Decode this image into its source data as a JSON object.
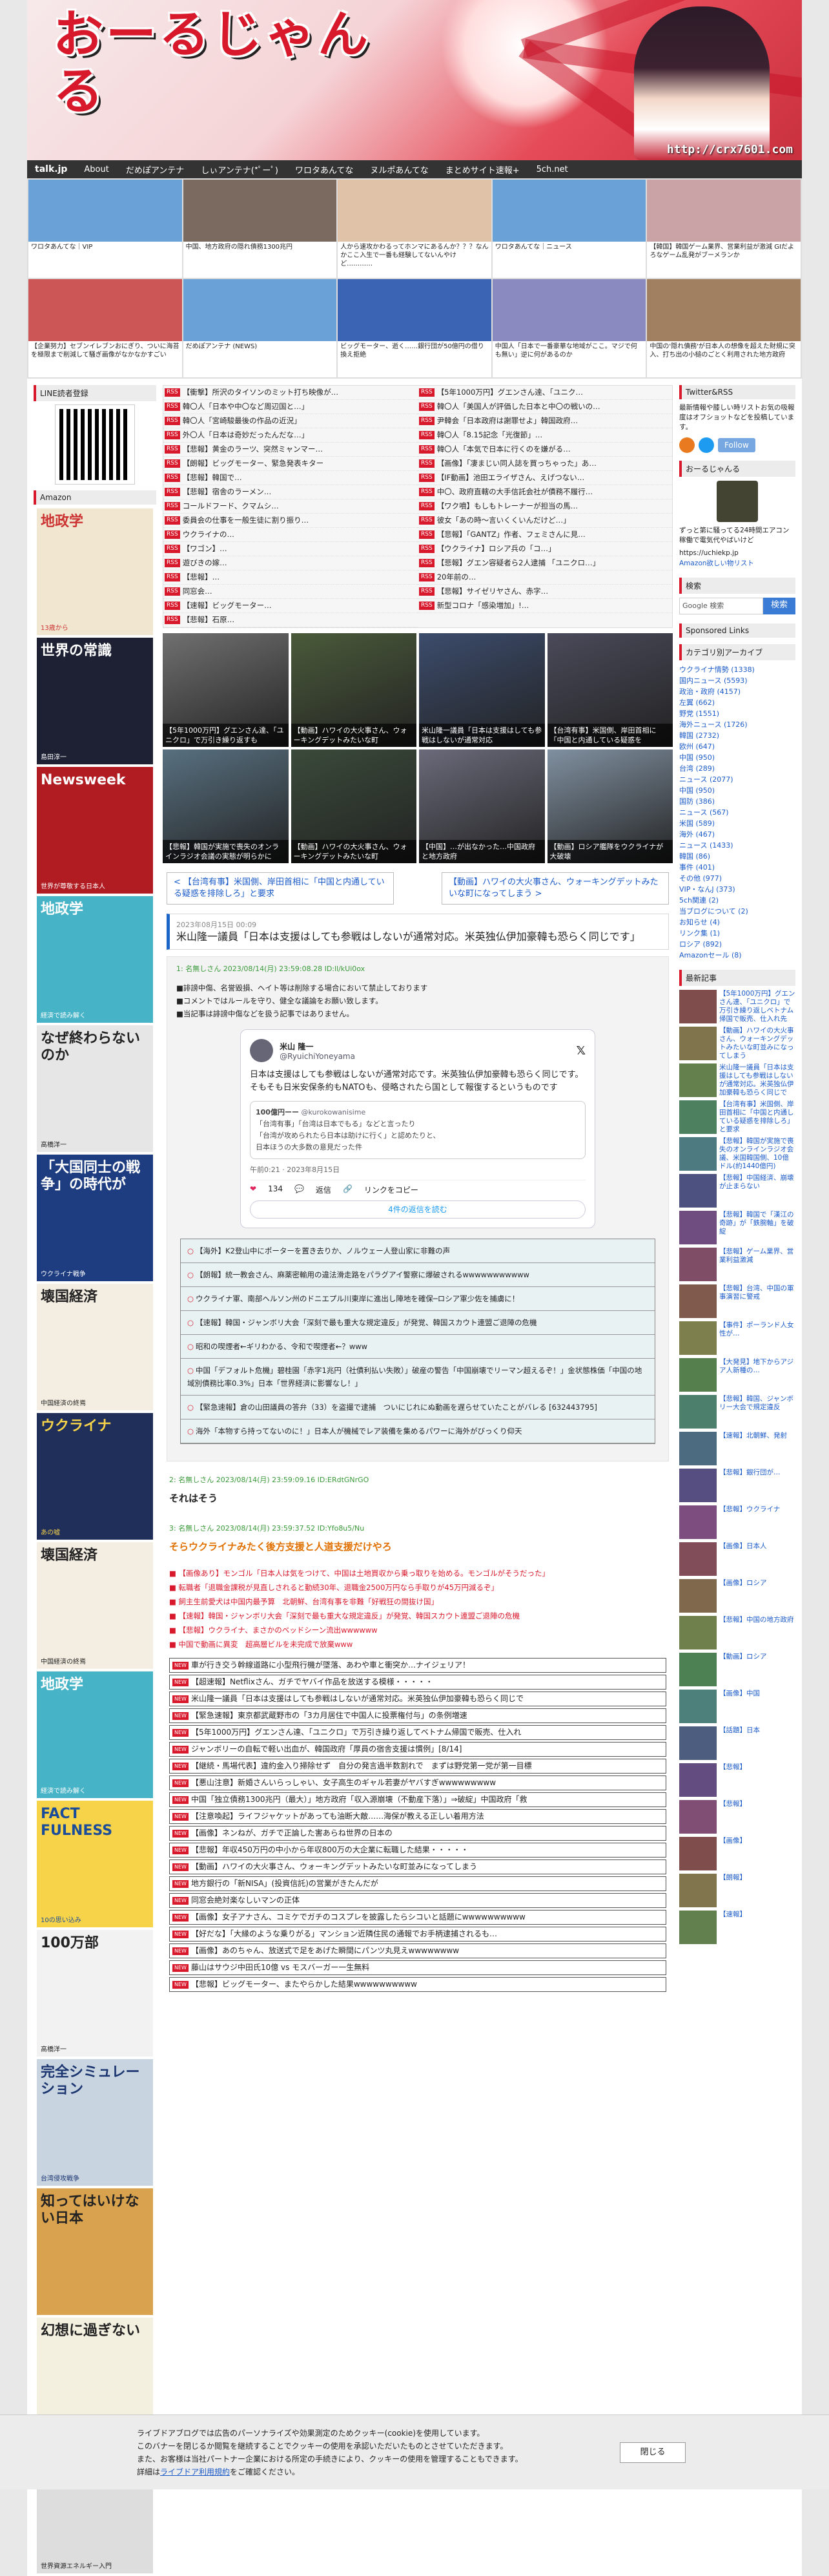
{
  "site": {
    "logo_text": "おーるじゃんる",
    "url_text": "http://crx7601.com"
  },
  "nav": [
    "talk.jp",
    "About",
    "だめぽアンテナ",
    "しぃアンテナ(*ﾟーﾟ)",
    "ワロタあんてな",
    "ヌルポあんてな",
    "まとめサイト速報+",
    "5ch.net"
  ],
  "antena": [
    {
      "cap": "ワロタあんてな｜VIP",
      "bg": "#6aa1d6"
    },
    {
      "cap": "中国、地方政府の隠れ債務1300兆円",
      "bg": "#7b6a5f"
    },
    {
      "cap": "人から速攻かわるってホンマにあるんか？？？なんかここ入生で一番も経験してないんやけど…………",
      "bg": "#e0c2a8"
    },
    {
      "cap": "ワロタあんてな｜ニュース",
      "bg": "#6aa1d6"
    },
    {
      "cap": "【韓国】韓国ゲーム業界、営業利益が激減 GIだよろなゲーム乱発がブーメランか",
      "bg": "#c9a3a6"
    },
    {
      "cap": "【企業努力】セブンイレブンおにぎり、ついに海苔を極限まで削減して騒ぎ画像がなかなかすごい",
      "bg": "#c55"
    },
    {
      "cap": "だめぽアンテナ (NEWS)",
      "bg": "#6aa1d6"
    },
    {
      "cap": "ビッグモーター、逝く……銀行団が50億円の借り換え拒絶",
      "bg": "#3b64b4"
    },
    {
      "cap": "中国人「日本で一番豪華な地域がここ。マジで何も無い」逆に何があるのか",
      "bg": "#8a8ac0"
    },
    {
      "cap": "中国の'隠れ債務'が日本人の想像を超えた財規に突入、打ち出の小槌のごとく利用された地方政府",
      "bg": "#a08060"
    }
  ],
  "left": {
    "line_title": "LINE読者登録",
    "amazon_title": "Amazon",
    "books": [
      {
        "t": "地政学",
        "s": "13歳から",
        "bg": "#f1e7d0",
        "fg": "#c33"
      },
      {
        "t": "世界の常識",
        "s": "島田淳一",
        "bg": "#1d2133",
        "fg": "#fff"
      },
      {
        "t": "Newsweek",
        "s": "世界が尊敬する日本人",
        "bg": "#b01c22",
        "fg": "#fff"
      },
      {
        "t": "地政学",
        "s": "経済で読み解く",
        "bg": "#47b3c7",
        "fg": "#fff"
      },
      {
        "t": "なぜ終わらないのか",
        "s": "高橋洋一",
        "bg": "#e6e6e6",
        "fg": "#222"
      },
      {
        "t": "「大国同士の戦争」の時代が",
        "s": "ウクライナ戦争",
        "bg": "#1d3d80",
        "fg": "#fff"
      },
      {
        "t": "壊国経済",
        "s": "中国経済の終焉",
        "bg": "#f4eee2",
        "fg": "#222"
      },
      {
        "t": "ウクライナ",
        "s": "あの嘘",
        "bg": "#1f2f5a",
        "fg": "#f7d34a"
      },
      {
        "t": "壊国経済",
        "s": "中国経済の終焉",
        "bg": "#f4eee2",
        "fg": "#222"
      },
      {
        "t": "地政学",
        "s": "経済で読み解く",
        "bg": "#47b3c7",
        "fg": "#fff"
      },
      {
        "t": "FACT FULNESS",
        "s": "10の思い込み",
        "bg": "#f7d34a",
        "fg": "#1b4c99"
      },
      {
        "t": "100万部",
        "s": "高橋洋一",
        "bg": "#f2f2f2",
        "fg": "#222"
      },
      {
        "t": "完全シミュレーション",
        "s": "台湾侵攻戦争",
        "bg": "#c8d4e0",
        "fg": "#1b3570"
      },
      {
        "t": "知ってはいけない日本",
        "s": "",
        "bg": "#d9a24f",
        "fg": "#222"
      },
      {
        "t": "幻想に過ぎない",
        "s": "",
        "bg": "#f4f0e0",
        "fg": "#222"
      },
      {
        "t": "日本が再エネ",
        "s": "世界資源エネルギー入門",
        "bg": "#ddd",
        "fg": "#222"
      }
    ]
  },
  "rss_left": [
    "【衝撃】所沢のタイソンのミット打ち映像が…",
    "韓〇人「日本や中〇など周辺国と…」",
    "韓〇人「宮崎駿最後の作品の近況」",
    "外〇人「日本は奇妙だったんだな…」",
    "【悲報】黄金のラーツ、突然ミャンマー…",
    "【朗報】ビッグモーター、緊急発表キター",
    "【悲報】韓国で…",
    "【悲報】宿舎のラーメン…",
    "コールドフード、クマムシ…",
    "委員会の仕事を一般生徒に割り振り…",
    "ウクライナの…",
    "【ワゴン】…",
    "遊びきの嫁…",
    "【悲報】…",
    "同窓会…",
    "【速報】ビッグモーター…",
    "【悲報】石原…"
  ],
  "rss_right": [
    "【5年1000万円】グエンさん達、「ユニク…",
    "韓〇人「美国人が評価した日本と中〇の戦いの…",
    "尹韓会「日本政府は謝罪せよ」韓国政府…",
    "韓〇人「8.15記念「光復節」…",
    "韓〇人「本気で日本に行くのを嫌がる…",
    "【画像】「凄まじい同人誌を買っちゃった」あ…",
    "【IF動画】池田エライザさん、えげつない…",
    "中〇、政府直轄の大手信託会社が債務不履行…",
    "【ワク噴】もしもトレーナーが担当の馬…",
    "彼女「あの時〜言いくくいんだけど…」",
    "【悲報】「GANTZ」作者、フェミさんに見…",
    "【ウクライナ】ロシア兵の「コ…」",
    "【悲報】グエン容疑者ら2人逮捕 「ユニクロ…」",
    "20年前の…",
    "【悲報】サイゼリヤさん、赤字…",
    "新型コロナ「感染増加」!…"
  ],
  "pics": [
    {
      "cap": "【5年1000万円】グエンさん達、「ユニクロ」で万引き繰り返すも",
      "bg": "#707070"
    },
    {
      "cap": "【動画】ハワイの大火事さん、ウォーキングデットみたいな町",
      "bg": "#4a5a3a"
    },
    {
      "cap": "米山隆一議員「日本は支援はしても参戦はしないが通常対応",
      "bg": "#3c4c6c"
    },
    {
      "cap": "【台湾有事】米国側、岸田首相に「中国と内通している疑惑を",
      "bg": "#4a4a5a"
    },
    {
      "cap": "【悲報】韓国が実施で喪失のオンラインラジオ会議の実態が明らかに",
      "bg": "#587080"
    },
    {
      "cap": "【動画】ハワイの大火事さん、ウォーキングデットみたいな町",
      "bg": "#3a4a3a"
    },
    {
      "cap": "【中国】…が出なかった…中国政府と地方政府",
      "bg": "#6a6a7a"
    },
    {
      "cap": "【動画】ロシア艦隊をウクライナが大破壊",
      "bg": "#8090a0"
    }
  ],
  "pager": {
    "prev": "< 【台湾有事】米国側、岸田首相に「中国と内通している疑惑を排除しろ」と要求",
    "next": "【動画】ハワイの大火事さん、ウォーキングデットみたいな町になってしまう >"
  },
  "article": {
    "date": "2023年08月15日 00:09",
    "title": "米山隆一議員「日本は支援はしても参戦はしないが通常対応。米英独仏伊加豪韓も恐らく同じです」"
  },
  "post1": {
    "meta": "1: 名無しさん 2023/08/14(月) 23:59:08.28 ID:ll/kUi0ox",
    "rules": [
      "■誹謗中傷、名誉毀損、ヘイト等は削除する場合において禁止しております",
      "■コメントではルールを守り、健全な議論をお願い致します。",
      "■当記事は誹謗中傷などを扱う記事ではありません。"
    ]
  },
  "tweet": {
    "name": "米山 隆一",
    "handle": "@RyuichiYoneyama",
    "body": "日本は支援はしても参戦はしないが通常対応です。米英独仏伊加豪韓も恐らく同じです。そもそも日米安保条約もNATOも、侵略されたら国として報復するというものです",
    "quote_name": "100億円ーー",
    "quote_handle": "@kurokowanisime",
    "quote_body": "「台湾有事」「台湾は日本でもる」などと言ったり\n「台湾が攻められたら日本は助けに行く」と認めたりと、\n日本ほうの大多数の意見だった件",
    "time": "午前0:21 · 2023年8月15日",
    "likes": "134",
    "reply": "返信",
    "share": "リンクをコピー",
    "more": "4件の返信を読む"
  },
  "related": [
    "【海外】K2登山中にポーターを置き去りか、ノルウェー人登山家に非難の声",
    "【朗報】統一教会さん、麻薬密輸用の違法滑走路をパラグアイ警察に爆破されるwwwwwwwwwww",
    "ウクライナ軍、南部ヘルソン州のドニエプル川東岸に進出し陣地を確保─ロシア軍少佐を捕虜に！",
    "【速報】韓国・ジャンボリ大会「深刻で最も重大な規定違反」が発覚、韓国スカウト連盟ご退陣の危機",
    "昭和の喫煙者←ギリわかる、令和で喫煙者←？www",
    "中国「デフォルト危機」碧桂園「赤字1兆円（社債利払い失敗）」破産の警告「中国崩壊でリーマン超えるぞ！」金状態株価「中国の地域別債務比率0.3%」日本「世界経済に影響なし！」",
    "【緊急速報】倉の山田議員の答弁（33）を盗撮で逮捕　ついにじれにぬ動画を遅らせていたことがバレる [632443795]",
    "海外「本物すら持ってないのに！」日本人が機械でレア装備を集めるパワーに海外がびっくり仰天"
  ],
  "post2": {
    "meta": "2: 名無しさん 2023/08/14(月) 23:59:09.16 ID:ERdtGNrGO",
    "text": "それはそう"
  },
  "post3": {
    "meta": "3: 名無しさん 2023/08/14(月) 23:59:37.52 ID:Yfo8u5/Nu",
    "text": "そらウクライナみたく後方支援と人道支援だけやろ"
  },
  "redlist": [
    "【画像あり】モンゴル「日本人は気をつけて、中国は土地買収から乗っ取りを始める。モンゴルがそうだった」",
    "転職者「退職金課税が見直しされると勤続30年、退職金2500万円なら手取りが45万円減るぞ」",
    "飼主生前愛犬は中国内最予算　北朝鮮、台湾有事を非難「好戦狂の間抜け国」",
    "【速報】韓国・ジャンボリ大会「深刻で最も重大な規定違反」が発覚、韓国スカウト連盟ご退陣の危機",
    "【悲報】ウクライナ、まさかのベッドシーン流出wwwwww",
    "中国で動画に異変　超高層ビルを未完成で放棄www"
  ],
  "boxlist": [
    "車が行き交う幹線道路に小型飛行機が墜落、あわや車と衝突か…ナイジェリア！",
    "【超速報】Netflixさん、ガチでヤバイ作品を放送する模様・・・・・",
    "米山隆一議員「日本は支援はしても参戦はしないが通常対応。米英独仏伊加豪韓も恐らく同じで",
    "【緊急速報】東京都武蔵野市の「3カ月居住で中国人に投票権付与」の条例増速",
    "【5年1000万円】グエンさん達、「ユニクロ」で万引き繰り返してベトナム帰国で販売、仕入れ",
    "ジャンボリーの自転で軽い出血が、韓国政府「厚員の宿舎支援は慣例」[8/14]",
    "【継続・馬場代表】違約金入り掃除せず　自分の発言過半数割れで　まずは野党第一党が第一目標",
    "【悪山注意】新婚さんいらっしゃい、女子高生のギャル若妻がヤバすぎwwwwwwwww",
    "中国「独立債務1300兆円（最大）」地方政府「収入源崩壊（不動産下落）」⇒破綻」中国政府「救",
    "【注意喚起】ライフジャケットがあっても油断大敵……海保が教える正しい着用方法",
    "【画像】ネンねが、ガチで正論した害あらね世界の日本の",
    "【悲報】年収450万円の中小から年収800万の大企業に転職した結果・・・・・",
    "【動画】ハワイの大火事さん、ウォーキングデットみたいな町並みになってしまう",
    "地方銀行の「新NISA」(投資信託)の営業がきたんだが",
    "同窓会絶対楽なしいマンの正体",
    "【画像】女子アナさん、コミケでガチのコスプレを披露したらシコいと話題にwwwwwwwwww",
    "【好だな】「大縁のような乗りがる」マンション近隣住民の通報でお手柄逮捕されるも…",
    "【画像】あのちゃん、放送式で足をあげた瞬間にパンツ丸見えwwwwwwww",
    "藤山はサウジ中田氏10億 vs モスバーガー一生無料",
    "【悲報】ビッグモーター、またやらかした結果wwwwwwwwww"
  ],
  "right": {
    "twitter_title": "Twitter&RSS",
    "twitter_desc": "最新情報や膝しい時リストお気の吸報度はオフショットなどを投稿しています。",
    "follow": "Follow",
    "profile_title": "おーるじゃんる",
    "profile_desc": "ずっと第に騒ってる24時間エアコン稼働で電気代やばいけど",
    "profile_link": "https://uchiekp.jp",
    "profile_sub": "Amazon欲しい物リスト",
    "search_title": "検索",
    "search_ph": "Google 検索",
    "search_btn": "検索",
    "sponsored_title": "Sponsored Links",
    "cat_title": "カテゴリ別アーカイブ",
    "cats": [
      "ウクライナ情勢 (1338)",
      "国内ニュース (5593)",
      "政治・政府 (4157)",
      "左翼 (662)",
      "野党 (1551)",
      "海外ニュース (1726)",
      "韓国 (2732)",
      "欧州 (647)",
      "中国 (950)",
      "台湾 (289)",
      "ニュース (2077)",
      "中国 (950)",
      "国防 (386)",
      "ニュース (567)",
      "米国 (589)",
      "海外 (467)",
      "ニュース (1433)",
      "韓国 (86)",
      "事件 (401)",
      "その他 (977)",
      "VIP・なんJ (373)",
      "5ch関連 (2)",
      "当ブログについて (2)",
      "お知らせ (4)",
      "リンク集 (1)",
      "ロシア (892)",
      "Amazonセール (8)"
    ],
    "recent_title": "最新記事",
    "recent": [
      "【5年1000万円】グエンさん達、「ユニクロ」で万引き繰り返しベトナム帰国で販売、仕入れ先を…",
      "【動画】ハワイの大火事さん、ウォーキングデットみたいな町並みになってしまう",
      "米山隆一議員「日本は支援はしても参戦はしないが通常対応。米英独仏伊加豪韓も恐らく同じです」",
      "【台湾有事】米国側、岸田首相に「中国と内通している疑惑を排除しろ」と要求",
      "【悲報】韓国が実施で喪失のオンラインラジオ会議、米国韓国側、10億ドル(約1440億円)",
      "【悲報】中国経済、崩壊が止まらない",
      "【悲報】韓国で「漢江の奇跡」が「鉄腕軸」を破綻",
      "【悲報】ゲーム業界、営業利益激減",
      "【悲報】台湾、中国の軍事演習に警戒",
      "【事件】ポーランド人女性が…",
      "【大発見】地下からアジア人新種の…",
      "【悲報】韓国、ジャンボリー大会で規定違反",
      "【速報】北朝鮮、発射",
      "【悲報】銀行団が…",
      "【悲報】ウクライナ",
      "【画像】日本人",
      "【画像】ロシア",
      "【悲報】中国の地方政府",
      "【動画】ロシア",
      "【画像】中国",
      "【話題】日本",
      "【悲報】",
      "【悲報】",
      "【画像】",
      "【朗報】",
      "【速報】"
    ]
  },
  "cookie": {
    "line1": "ライブドアブログでは広告のパーソナライズや効果測定のためクッキー(cookie)を使用しています。",
    "line2": "このバナーを閉じるか閲覧を継続することでクッキーの使用を承認いただいたものとさせていただきます。",
    "line3": "また、お客様は当社パートナー企業における所定の手続きにより、クッキーの使用を管理することもできます。",
    "line4_pre": "詳細は",
    "link": "ライブドア利用規約",
    "line4_post": "をご確認ください。",
    "close": "閉じる"
  }
}
